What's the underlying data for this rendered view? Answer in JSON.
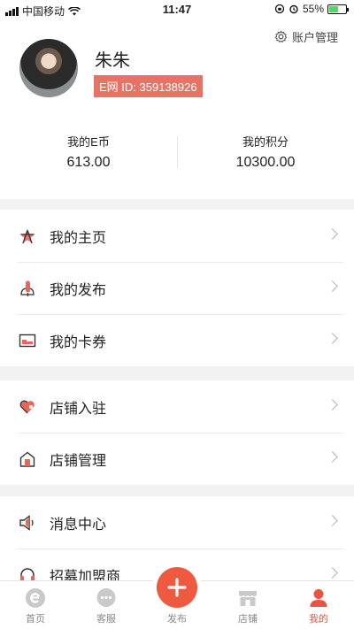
{
  "status_bar": {
    "carrier": "中国移动",
    "time": "11:47",
    "battery": "55%",
    "battery_level": 0.55
  },
  "header": {
    "account_mgmt_label": "账户管理",
    "user_name": "朱朱",
    "user_id": "E网 ID: 359138926",
    "stats": [
      {
        "label": "我的E币",
        "value": "613.00"
      },
      {
        "label": "我的积分",
        "value": "10300.00"
      }
    ]
  },
  "groups": [
    {
      "items": [
        {
          "label": "我的主页",
          "icon": "star-icon"
        },
        {
          "label": "我的发布",
          "icon": "pen-icon"
        },
        {
          "label": "我的卡券",
          "icon": "coupon-icon"
        }
      ]
    },
    {
      "items": [
        {
          "label": "店铺入驻",
          "icon": "heart-icon"
        },
        {
          "label": "店铺管理",
          "icon": "house-icon"
        }
      ]
    },
    {
      "items": [
        {
          "label": "消息中心",
          "icon": "speaker-icon"
        },
        {
          "label": "招募加盟商",
          "icon": "headset-icon"
        }
      ]
    }
  ],
  "tabbar": {
    "tabs": [
      {
        "label": "首页",
        "icon": "home-e-icon"
      },
      {
        "label": "客服",
        "icon": "chat-icon"
      },
      {
        "label": "发布",
        "icon": "plus-icon"
      },
      {
        "label": "店铺",
        "icon": "store-icon"
      },
      {
        "label": "我的",
        "icon": "person-icon"
      }
    ],
    "active_index": 4
  },
  "colors": {
    "accent": "#ee5a3f",
    "id_badge": "#e67366",
    "icon_red": "#e8675a"
  }
}
